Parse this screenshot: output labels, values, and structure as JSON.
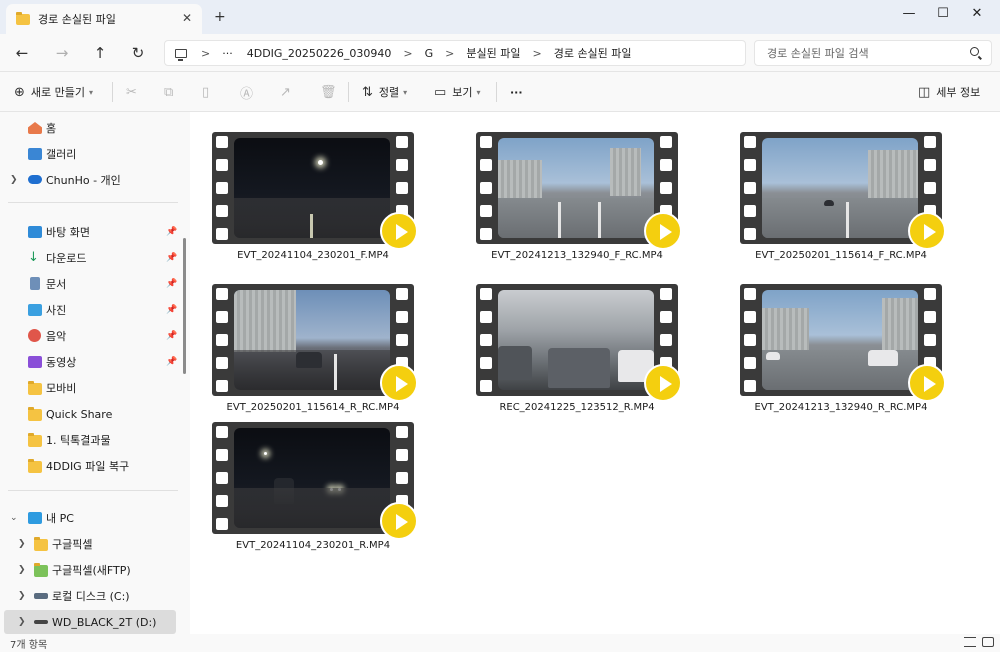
{
  "window": {
    "tab_title": "경로 손실된 파일",
    "tab_close": "✕",
    "new_tab": "+",
    "minimize": "—",
    "maximize": "☐",
    "close": "✕"
  },
  "nav": {
    "back": "←",
    "forward": "→",
    "up": "↑",
    "refresh": "↻",
    "address_more": "···",
    "breadcrumb": [
      "4DDIG_20250226_030940",
      "G",
      "분실된 파일",
      "경로 손실된 파일"
    ],
    "separator": ">",
    "search_placeholder": "경로 손실된 파일 검색"
  },
  "commands": {
    "new": "새로 만들기",
    "sort": "정렬",
    "view": "보기",
    "more": "···",
    "details": "세부 정보"
  },
  "sidebar": {
    "home": "홈",
    "gallery": "갤러리",
    "onedrive": "ChunHo - 개인",
    "quick": [
      {
        "label": "바탕 화면",
        "pinned": true
      },
      {
        "label": "다운로드",
        "pinned": true
      },
      {
        "label": "문서",
        "pinned": true
      },
      {
        "label": "사진",
        "pinned": true
      },
      {
        "label": "음악",
        "pinned": true
      },
      {
        "label": "동영상",
        "pinned": true
      },
      {
        "label": "모바비",
        "pinned": false
      },
      {
        "label": "Quick Share",
        "pinned": false
      },
      {
        "label": "1. 틱톡결과물",
        "pinned": false
      },
      {
        "label": "4DDIG 파일 복구",
        "pinned": false
      }
    ],
    "this_pc": "내 PC",
    "drives": [
      {
        "label": "구글픽셀"
      },
      {
        "label": "구글픽셀(새FTP)"
      },
      {
        "label": "로컬 디스크 (C:)"
      },
      {
        "label": "WD_BLACK_2T (D:)"
      }
    ]
  },
  "files": [
    {
      "name": "EVT_20241104_230201_F.MP4",
      "scene": "night"
    },
    {
      "name": "EVT_20241213_132940_F_RC.MP4",
      "scene": "day"
    },
    {
      "name": "EVT_20250201_115614_F_RC.MP4",
      "scene": "day"
    },
    {
      "name": "EVT_20250201_115614_R_RC.MP4",
      "scene": "dusk"
    },
    {
      "name": "REC_20241225_123512_R.MP4",
      "scene": "garage"
    },
    {
      "name": "EVT_20241213_132940_R_RC.MP4",
      "scene": "day"
    },
    {
      "name": "EVT_20241104_230201_R.MP4",
      "scene": "night"
    }
  ],
  "status": {
    "item_count": "7개 항목"
  },
  "colors": {
    "accent": "#0067c0",
    "play_button": "#f4cf0f",
    "folder": "#f5c342"
  }
}
